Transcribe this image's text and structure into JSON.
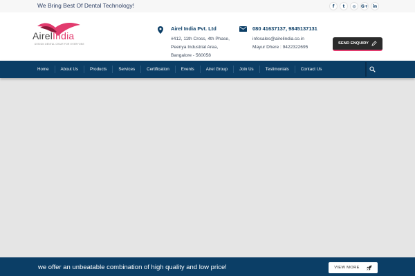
{
  "topbar": {
    "tagline": "We Bring Best Of Dental Technology!",
    "social": [
      {
        "icon": "facebook-icon",
        "glyph": "f"
      },
      {
        "icon": "twitter-icon",
        "glyph": "t"
      },
      {
        "icon": "instagram-icon",
        "glyph": "◎"
      },
      {
        "icon": "google-plus-icon",
        "glyph": "G+"
      },
      {
        "icon": "linkedin-icon",
        "glyph": "in"
      }
    ]
  },
  "header": {
    "logo": {
      "part1": "Airel",
      "part2": "India",
      "sub": "DESIGN DENTAL CHAIR FOR EVERYONE"
    },
    "address": {
      "title": "Airel India Pvt. Ltd",
      "lines": [
        "#412, 11th Cross, 4th Phase,",
        "Peenya Industrial Area,",
        "Bangalore - 560058"
      ]
    },
    "contact": {
      "title": "080 41637137, 9845137131",
      "lines": [
        "infosales@airelindia.co.in",
        "Mayur Dhere : 9422322695"
      ]
    },
    "enquiry_label": "SEND ENQUIRY"
  },
  "nav": {
    "items": [
      "Home",
      "About Us",
      "Products",
      "Services",
      "Certification",
      "Events",
      "Airel Group",
      "Join Us",
      "Testimonials",
      "Contact Us"
    ]
  },
  "banner": {
    "text": "we offer an unbeatable combination of high quality and low price!",
    "button_label": "VIEW MORE"
  },
  "colors": {
    "primary": "#0b3e66",
    "accent": "#e23b6e",
    "dark": "#2b2b2b"
  }
}
